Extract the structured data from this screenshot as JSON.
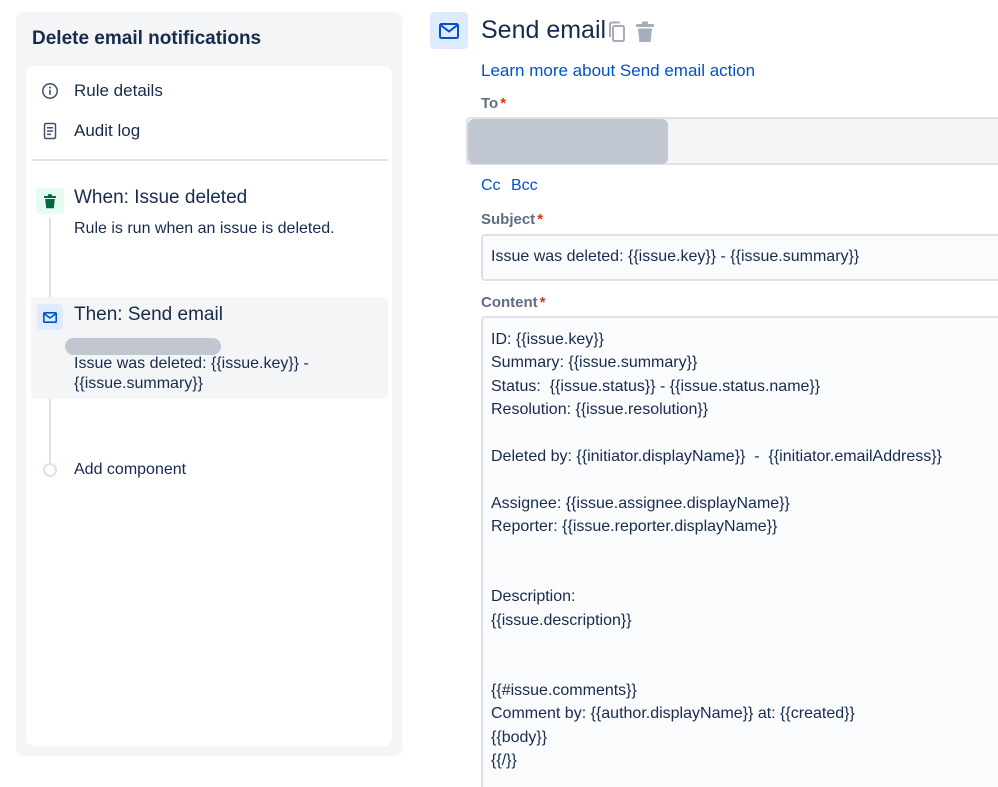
{
  "rule_panel": {
    "title": "Delete email notifications",
    "links": [
      {
        "label": "Rule details",
        "icon": "info-icon"
      },
      {
        "label": "Audit log",
        "icon": "document-icon"
      }
    ],
    "trigger": {
      "title": "When: Issue deleted",
      "description": "Rule is run when an issue is deleted.",
      "icon": "trash-icon",
      "icon_color": "#006644"
    },
    "action": {
      "title": "Then: Send email",
      "summary": "Issue was deleted: {{issue.key}} - {{issue.summary}}",
      "icon": "mail-icon",
      "icon_color": "#0052cc"
    },
    "add_component_label": "Add component"
  },
  "send_email": {
    "title": "Send email",
    "icon": "mail-icon",
    "learn_more_label": "Learn more about Send email action",
    "to_label": "To",
    "cc_label": "Cc",
    "bcc_label": "Bcc",
    "subject_label": "Subject",
    "subject_value": "Issue was deleted: {{issue.key}} - {{issue.summary}}",
    "content_label": "Content",
    "content_lines": [
      "ID: {{issue.key}}",
      "Summary: {{issue.summary}}",
      "Status:  {{issue.status}} - {{issue.status.name}}",
      "Resolution: {{issue.resolution}}",
      "",
      "Deleted by: {{initiator.displayName}}  -  {{initiator.emailAddress}}",
      "",
      "Assignee: {{issue.assignee.displayName}}",
      "Reporter: {{issue.reporter.displayName}}",
      "",
      "",
      "Description:",
      "{{issue.description}}",
      "",
      "",
      "{{#issue.comments}}",
      "Comment by: {{author.displayName}} at: {{created}}",
      "{{body}}",
      "{{/}}"
    ]
  },
  "colors": {
    "link": "#0052cc",
    "required": "#de350b",
    "text": "#172b4d",
    "muted": "#5e6c84"
  }
}
